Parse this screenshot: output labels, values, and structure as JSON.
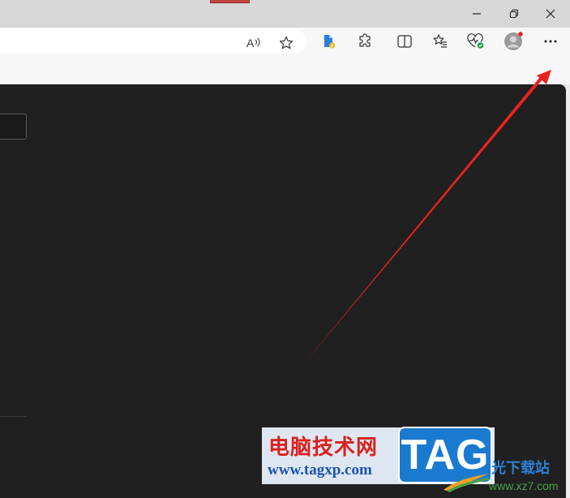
{
  "window": {
    "minimize_icon": "minimize-icon",
    "restore_icon": "restore-icon",
    "close_icon": "close-icon"
  },
  "toolbar": {
    "read_aloud_icon": "read-aloud-icon",
    "favorite_icon": "star-icon",
    "extension_icons": [
      "file-extension-icon",
      "puzzle-icon"
    ],
    "split_screen_icon": "split-screen-icon",
    "favorites_icon": "favorites-icon",
    "browser_essentials_icon": "heart-pulse-icon",
    "profile_icon": "avatar-icon",
    "more_icon": "ellipsis-icon"
  },
  "annotation": {
    "arrow_color": "#e8231f"
  },
  "watermark": {
    "site_name": "电脑技术网",
    "url": "www.tagxp.com",
    "badge": "TAG",
    "download_text": "光下载站",
    "download_url": "www.xz7.com"
  },
  "colors": {
    "content_bg": "#202020",
    "toolbar_bg": "#f7f7f7",
    "titlebar_bg": "#d7d7d7"
  }
}
